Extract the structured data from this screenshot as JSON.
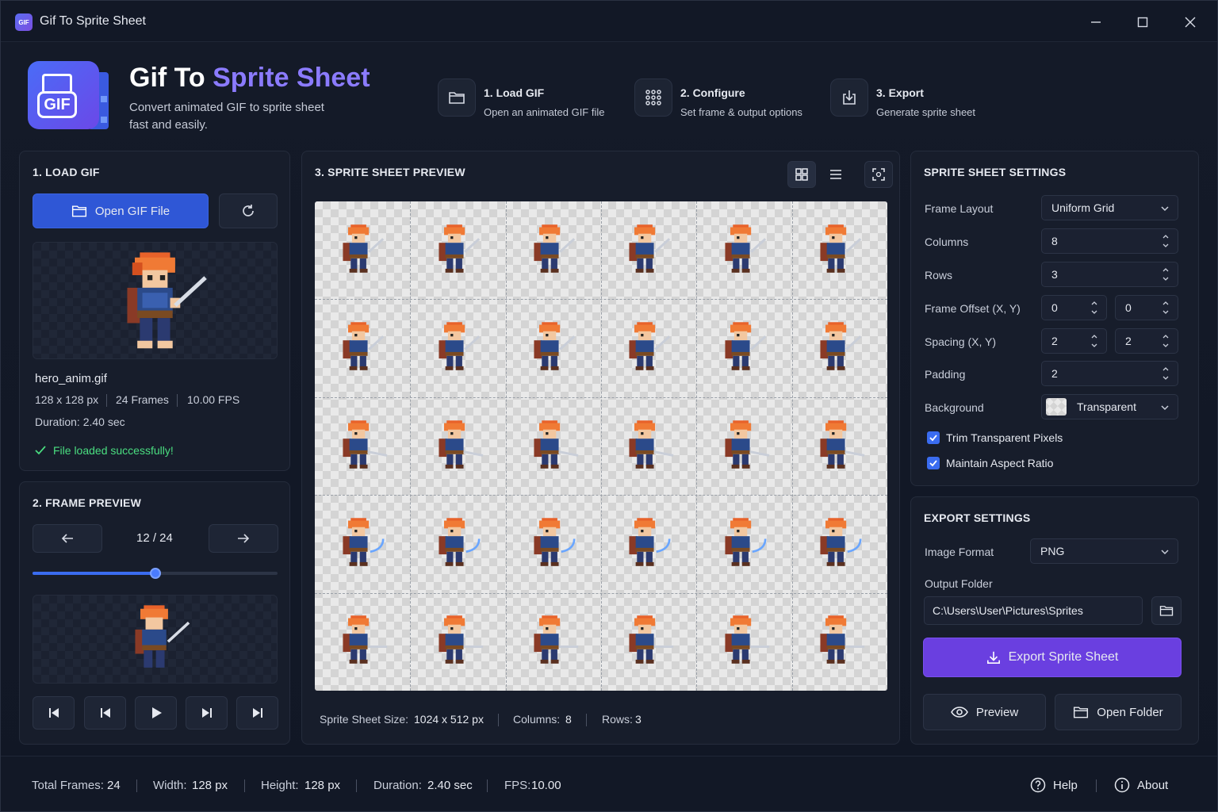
{
  "window": {
    "title": "Gif To Sprite Sheet",
    "icon_text": "GIF",
    "minimize_icon": "minimize-icon",
    "maximize_icon": "maximize-icon",
    "close_icon": "close-icon"
  },
  "header": {
    "title_main": "Gif To ",
    "title_accent": "Sprite Sheet",
    "subtitle": "Convert animated GIF to sprite sheet fast and easily.",
    "logo_text": "GIF",
    "accent_color": "#8b7bff",
    "steps": [
      {
        "title": "1. Load GIF",
        "desc": "Open an animated GIF file",
        "icon": "folder-icon"
      },
      {
        "title": "2. Configure",
        "desc": "Set frame & output options",
        "icon": "grid-dots-icon"
      },
      {
        "title": "3. Export",
        "desc": "Generate sprite sheet",
        "icon": "export-icon"
      }
    ]
  },
  "load_gif": {
    "title": "1. LOAD GIF",
    "open_button": "Open GIF File",
    "file_name": "hero_anim.gif",
    "dimensions": "128 x 128 px",
    "frames": "24 Frames",
    "fps": "10.00 FPS",
    "duration": "Duration: 2.40 sec",
    "status": "File loaded successfully!",
    "status_color": "#4ade80"
  },
  "frame_preview": {
    "title": "2. FRAME PREVIEW",
    "counter": "12 / 24",
    "progress": 0.5
  },
  "preview": {
    "title": "3. SPRITE SHEET PREVIEW",
    "grid_columns": 6,
    "grid_rows": 5,
    "size_label": "Sprite Sheet Size:",
    "size_value": "1024 x 512 px",
    "columns_label": "Columns:",
    "columns_value": "8",
    "rows_label": "Rows:",
    "rows_value": "3"
  },
  "settings": {
    "title": "SPRITE SHEET SETTINGS",
    "frame_layout_label": "Frame Layout",
    "frame_layout_value": "Uniform Grid",
    "columns_label": "Columns",
    "columns_value": "8",
    "rows_label": "Rows",
    "rows_value": "3",
    "offset_label": "Frame Offset (X, Y)",
    "offset_x": "0",
    "offset_y": "0",
    "spacing_label": "Spacing (X, Y)",
    "spacing_x": "2",
    "spacing_y": "2",
    "padding_label": "Padding",
    "padding_value": "2",
    "background_label": "Background",
    "background_value": "Transparent",
    "trim_label": "Trim Transparent Pixels",
    "trim_checked": true,
    "aspect_label": "Maintain Aspect Ratio",
    "aspect_checked": true
  },
  "export": {
    "title": "EXPORT SETTINGS",
    "format_label": "Image Format",
    "format_value": "PNG",
    "folder_label": "Output Folder",
    "folder_value": "C:\\Users\\User\\Pictures\\Sprites",
    "export_button": "Export Sprite Sheet",
    "preview_button": "Preview",
    "open_folder_button": "Open Folder"
  },
  "statusbar": {
    "total_frames_label": "Total Frames:",
    "total_frames": "24",
    "width_label": "Width:",
    "width": "128 px",
    "height_label": "Height:",
    "height": "128 px",
    "duration_label": "Duration:",
    "duration": "2.40 sec",
    "fps_label": "FPS:",
    "fps": "10.00",
    "help": "Help",
    "about": "About"
  }
}
